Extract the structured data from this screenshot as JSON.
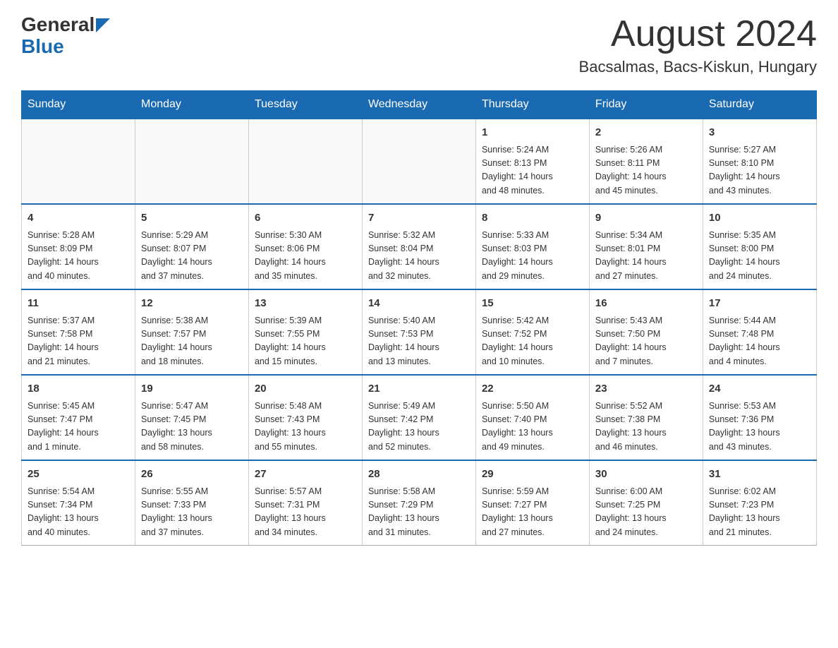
{
  "header": {
    "logo_general": "General",
    "logo_blue": "Blue",
    "month_title": "August 2024",
    "location": "Bacsalmas, Bacs-Kiskun, Hungary"
  },
  "weekdays": [
    "Sunday",
    "Monday",
    "Tuesday",
    "Wednesday",
    "Thursday",
    "Friday",
    "Saturday"
  ],
  "weeks": [
    [
      {
        "day": "",
        "info": ""
      },
      {
        "day": "",
        "info": ""
      },
      {
        "day": "",
        "info": ""
      },
      {
        "day": "",
        "info": ""
      },
      {
        "day": "1",
        "info": "Sunrise: 5:24 AM\nSunset: 8:13 PM\nDaylight: 14 hours\nand 48 minutes."
      },
      {
        "day": "2",
        "info": "Sunrise: 5:26 AM\nSunset: 8:11 PM\nDaylight: 14 hours\nand 45 minutes."
      },
      {
        "day": "3",
        "info": "Sunrise: 5:27 AM\nSunset: 8:10 PM\nDaylight: 14 hours\nand 43 minutes."
      }
    ],
    [
      {
        "day": "4",
        "info": "Sunrise: 5:28 AM\nSunset: 8:09 PM\nDaylight: 14 hours\nand 40 minutes."
      },
      {
        "day": "5",
        "info": "Sunrise: 5:29 AM\nSunset: 8:07 PM\nDaylight: 14 hours\nand 37 minutes."
      },
      {
        "day": "6",
        "info": "Sunrise: 5:30 AM\nSunset: 8:06 PM\nDaylight: 14 hours\nand 35 minutes."
      },
      {
        "day": "7",
        "info": "Sunrise: 5:32 AM\nSunset: 8:04 PM\nDaylight: 14 hours\nand 32 minutes."
      },
      {
        "day": "8",
        "info": "Sunrise: 5:33 AM\nSunset: 8:03 PM\nDaylight: 14 hours\nand 29 minutes."
      },
      {
        "day": "9",
        "info": "Sunrise: 5:34 AM\nSunset: 8:01 PM\nDaylight: 14 hours\nand 27 minutes."
      },
      {
        "day": "10",
        "info": "Sunrise: 5:35 AM\nSunset: 8:00 PM\nDaylight: 14 hours\nand 24 minutes."
      }
    ],
    [
      {
        "day": "11",
        "info": "Sunrise: 5:37 AM\nSunset: 7:58 PM\nDaylight: 14 hours\nand 21 minutes."
      },
      {
        "day": "12",
        "info": "Sunrise: 5:38 AM\nSunset: 7:57 PM\nDaylight: 14 hours\nand 18 minutes."
      },
      {
        "day": "13",
        "info": "Sunrise: 5:39 AM\nSunset: 7:55 PM\nDaylight: 14 hours\nand 15 minutes."
      },
      {
        "day": "14",
        "info": "Sunrise: 5:40 AM\nSunset: 7:53 PM\nDaylight: 14 hours\nand 13 minutes."
      },
      {
        "day": "15",
        "info": "Sunrise: 5:42 AM\nSunset: 7:52 PM\nDaylight: 14 hours\nand 10 minutes."
      },
      {
        "day": "16",
        "info": "Sunrise: 5:43 AM\nSunset: 7:50 PM\nDaylight: 14 hours\nand 7 minutes."
      },
      {
        "day": "17",
        "info": "Sunrise: 5:44 AM\nSunset: 7:48 PM\nDaylight: 14 hours\nand 4 minutes."
      }
    ],
    [
      {
        "day": "18",
        "info": "Sunrise: 5:45 AM\nSunset: 7:47 PM\nDaylight: 14 hours\nand 1 minute."
      },
      {
        "day": "19",
        "info": "Sunrise: 5:47 AM\nSunset: 7:45 PM\nDaylight: 13 hours\nand 58 minutes."
      },
      {
        "day": "20",
        "info": "Sunrise: 5:48 AM\nSunset: 7:43 PM\nDaylight: 13 hours\nand 55 minutes."
      },
      {
        "day": "21",
        "info": "Sunrise: 5:49 AM\nSunset: 7:42 PM\nDaylight: 13 hours\nand 52 minutes."
      },
      {
        "day": "22",
        "info": "Sunrise: 5:50 AM\nSunset: 7:40 PM\nDaylight: 13 hours\nand 49 minutes."
      },
      {
        "day": "23",
        "info": "Sunrise: 5:52 AM\nSunset: 7:38 PM\nDaylight: 13 hours\nand 46 minutes."
      },
      {
        "day": "24",
        "info": "Sunrise: 5:53 AM\nSunset: 7:36 PM\nDaylight: 13 hours\nand 43 minutes."
      }
    ],
    [
      {
        "day": "25",
        "info": "Sunrise: 5:54 AM\nSunset: 7:34 PM\nDaylight: 13 hours\nand 40 minutes."
      },
      {
        "day": "26",
        "info": "Sunrise: 5:55 AM\nSunset: 7:33 PM\nDaylight: 13 hours\nand 37 minutes."
      },
      {
        "day": "27",
        "info": "Sunrise: 5:57 AM\nSunset: 7:31 PM\nDaylight: 13 hours\nand 34 minutes."
      },
      {
        "day": "28",
        "info": "Sunrise: 5:58 AM\nSunset: 7:29 PM\nDaylight: 13 hours\nand 31 minutes."
      },
      {
        "day": "29",
        "info": "Sunrise: 5:59 AM\nSunset: 7:27 PM\nDaylight: 13 hours\nand 27 minutes."
      },
      {
        "day": "30",
        "info": "Sunrise: 6:00 AM\nSunset: 7:25 PM\nDaylight: 13 hours\nand 24 minutes."
      },
      {
        "day": "31",
        "info": "Sunrise: 6:02 AM\nSunset: 7:23 PM\nDaylight: 13 hours\nand 21 minutes."
      }
    ]
  ]
}
